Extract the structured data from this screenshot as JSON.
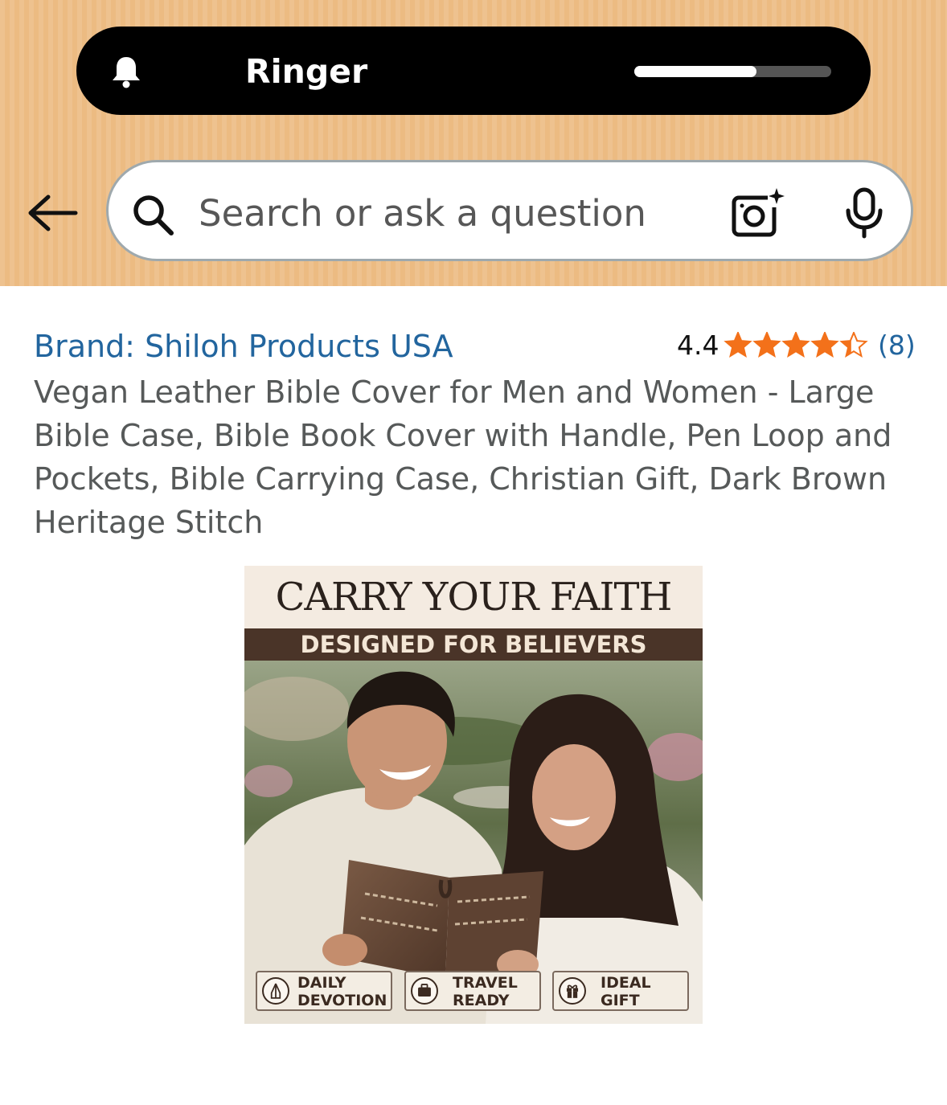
{
  "status": {
    "ringer_label": "Ringer",
    "ringer_level": 0.62
  },
  "search": {
    "placeholder": "Search or ask a question"
  },
  "product": {
    "brand": "Brand: Shiloh Products USA",
    "rating_value": "4.4",
    "rating_count": "(8)",
    "rating_stars": 4.4,
    "title": "Vegan Leather Bible Cover for Men and Women - Large Bible Case, Bible Book Cover with Handle, Pen Loop and Pockets, Bible Carrying Case, Christian Gift, Dark Brown Heritage Stitch",
    "image": {
      "headline": "CARRY YOUR FAITH",
      "subheadline": "DESIGNED FOR BELIEVERS",
      "badges": [
        {
          "line1": "DAILY",
          "line2": "DEVOTION",
          "icon": "praying-hands-icon"
        },
        {
          "line1": "TRAVEL",
          "line2": "READY",
          "icon": "suitcase-icon"
        },
        {
          "line1": "IDEAL",
          "line2": "GIFT",
          "icon": "gift-icon"
        }
      ]
    }
  },
  "colors": {
    "header_bg": "#ecbb82",
    "brand_link": "#22659e",
    "star": "#f3711a",
    "title_text": "#565959"
  }
}
